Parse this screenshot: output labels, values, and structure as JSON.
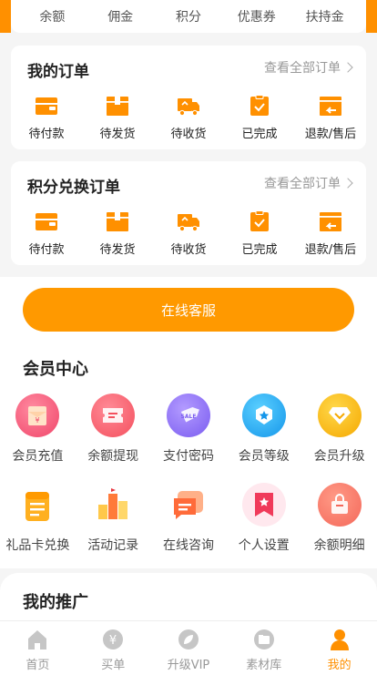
{
  "wallet": {
    "items": [
      "余额",
      "佣金",
      "积分",
      "优惠券",
      "扶持金"
    ]
  },
  "orders": {
    "title": "我的订单",
    "view_all": "查看全部订单",
    "items": [
      "待付款",
      "待发货",
      "待收货",
      "已完成",
      "退款/售后"
    ]
  },
  "points_orders": {
    "title": "积分兑换订单",
    "view_all": "查看全部订单",
    "items": [
      "待付款",
      "待发货",
      "待收货",
      "已完成",
      "退款/售后"
    ]
  },
  "service_button": "在线客服",
  "member_center": {
    "title": "会员中心",
    "row1": [
      "会员充值",
      "余额提现",
      "支付密码",
      "会员等级",
      "会员升级"
    ],
    "row2": [
      "礼品卡兑换",
      "活动记录",
      "在线咨询",
      "个人设置",
      "余额明细"
    ]
  },
  "promotion": {
    "title": "我的推广"
  },
  "tabbar": {
    "items": [
      "首页",
      "买单",
      "升级VIP",
      "素材库",
      "我的"
    ],
    "active_index": 4
  },
  "colors": {
    "accent": "#ff9000",
    "muted": "#999999"
  }
}
